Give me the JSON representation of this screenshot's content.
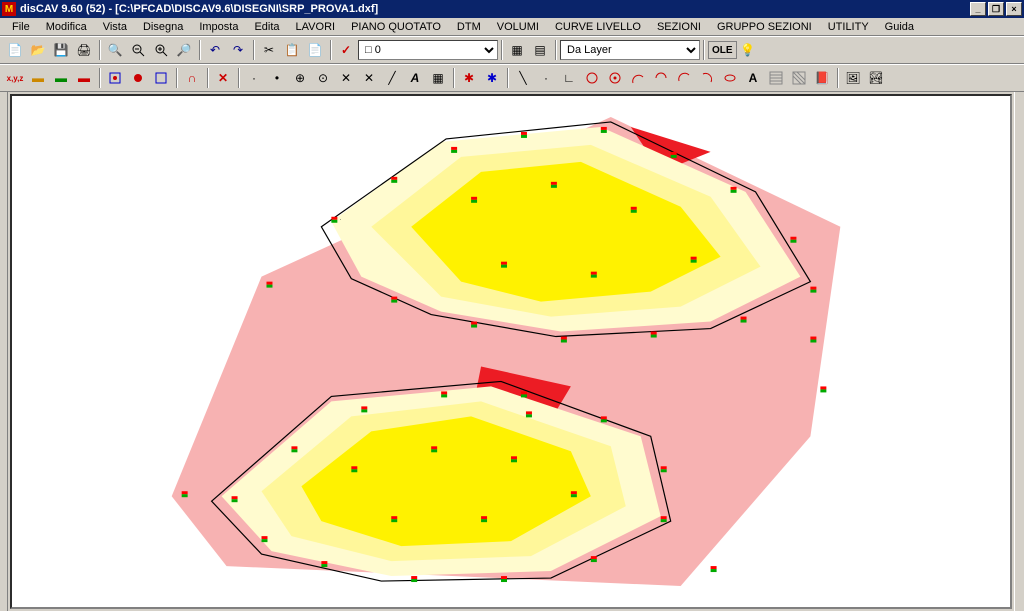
{
  "title": "disCAV 9.60 (52) - [C:\\PFCAD\\DISCAV9.6\\DISEGNI\\SRP_PROVA1.dxf]",
  "app_icon_text": "M",
  "menu": [
    "File",
    "Modifica",
    "Vista",
    "Disegna",
    "Imposta",
    "Edita",
    "LAVORI",
    "PIANO QUOTATO",
    "DTM",
    "VOLUMI",
    "CURVE LIVELLO",
    "SEZIONI",
    "GRUPPO SEZIONI",
    "UTILITY",
    "Guida"
  ],
  "toolbar1": {
    "layer_value": "0",
    "layer_color": "#FFFFFF",
    "source_value": "Da Layer",
    "ole_label": "OLE"
  },
  "winbtns": {
    "min": "_",
    "max": "❐",
    "close": "×",
    "restore": "❐"
  }
}
